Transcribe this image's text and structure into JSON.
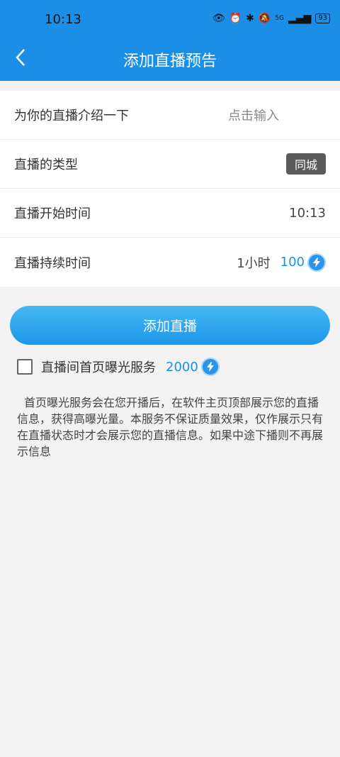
{
  "status_bar": {
    "time": "10:13",
    "battery": "93",
    "network": "5G"
  },
  "header": {
    "title": "添加直播预告",
    "back_icon": "back-arrow-icon"
  },
  "form": {
    "rows": [
      {
        "label": "为你的直播介绍一下",
        "value": "点击输入"
      },
      {
        "label": "直播的类型",
        "value": "同城"
      },
      {
        "label": "直播开始时间",
        "value": "10:13"
      },
      {
        "label": "直播持续时间",
        "value": "1小时",
        "price": "100"
      }
    ]
  },
  "add_button": {
    "label": "添加直播"
  },
  "service": {
    "label": "直播间首页曝光服务",
    "price": "2000",
    "checked": false
  },
  "description": "首页曝光服务会在您开播后，在软件主页顶部展示您的直播信息，获得高曝光量。本服务不保证质量效果，仅作展示只有在直播状态时才会展示您的直播信息。如果中途下播则不再展示信息",
  "colors": {
    "primary": "#1b8fe6",
    "tag_bg": "#5a5a5a",
    "page_bg": "#f2f2f2"
  }
}
